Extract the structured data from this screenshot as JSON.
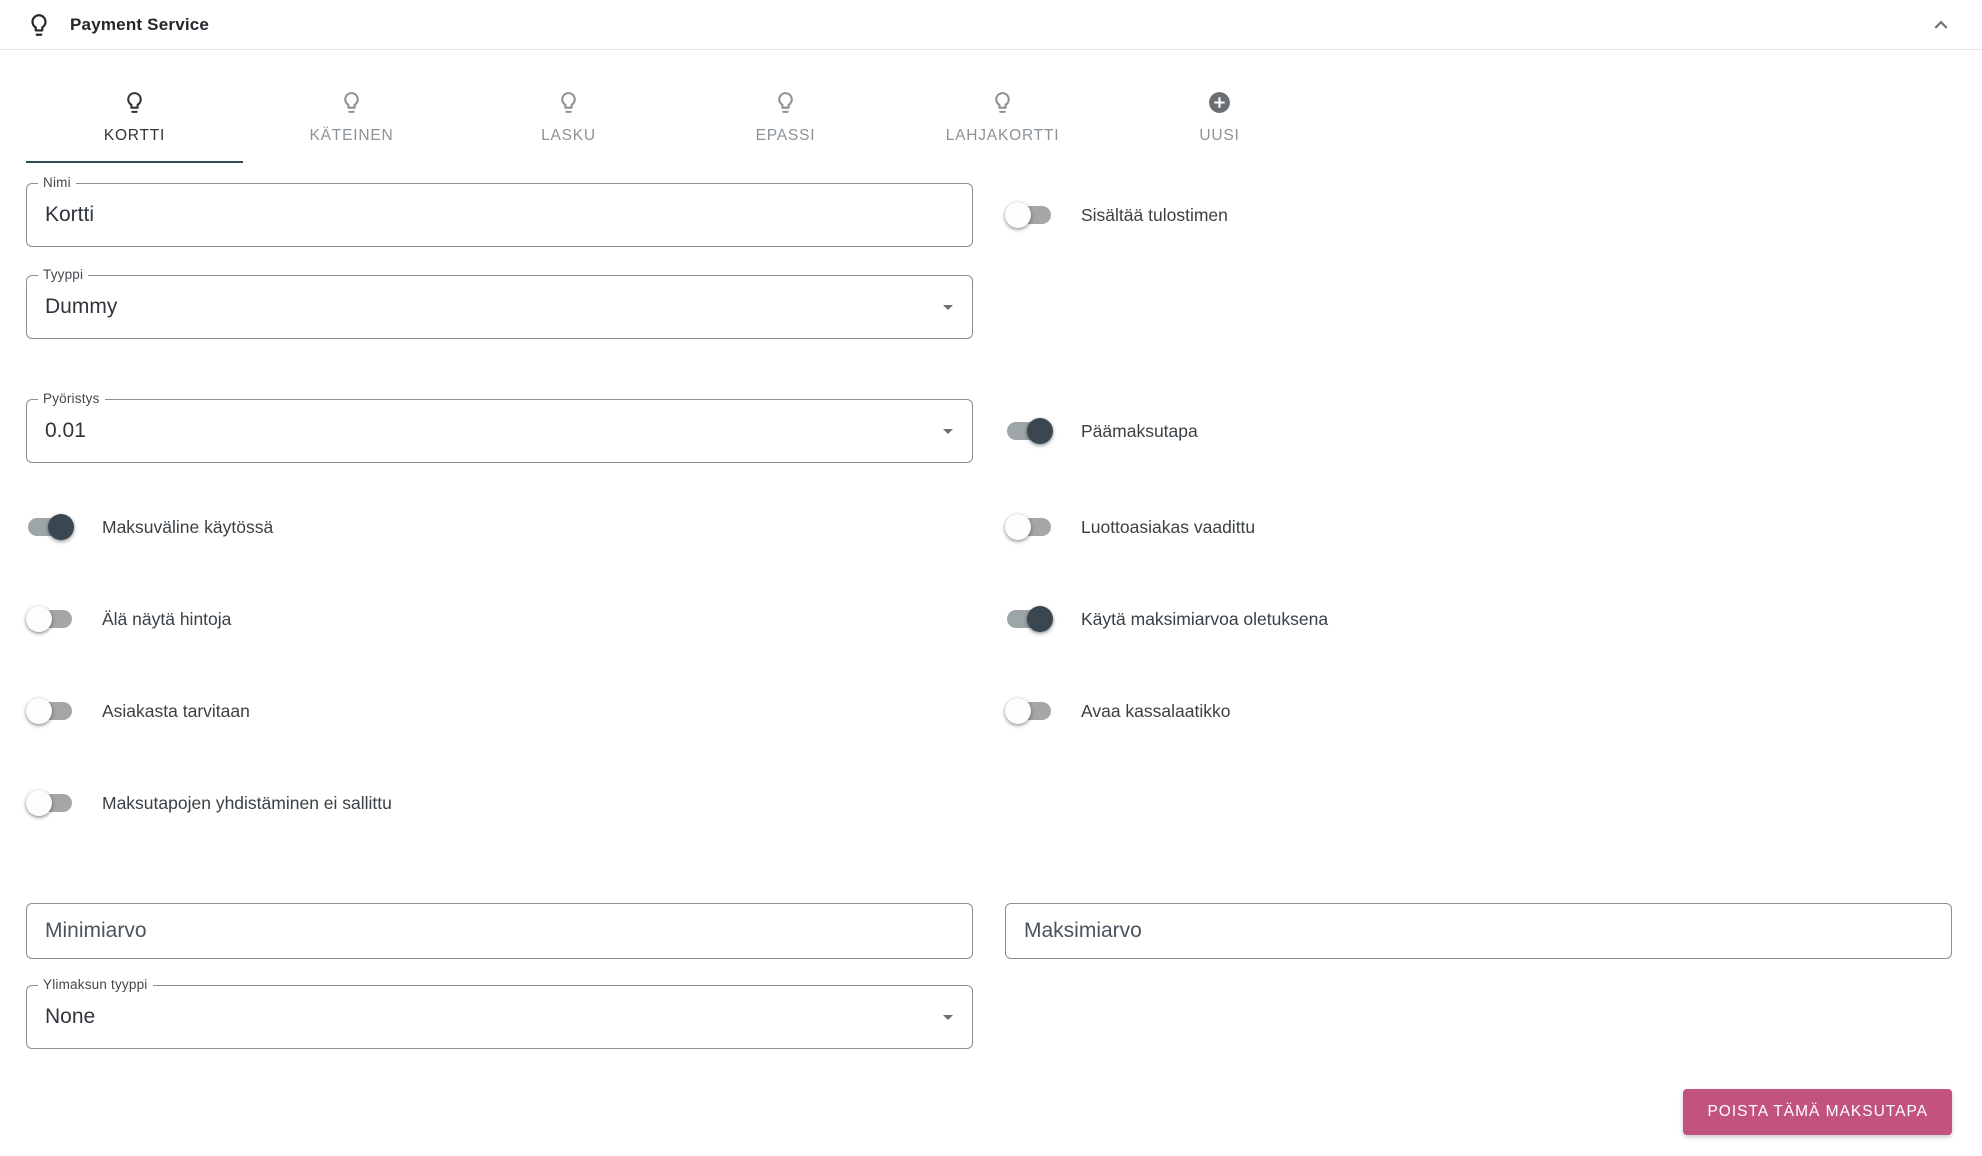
{
  "header": {
    "title": "Payment Service",
    "icon": "lightbulb-icon",
    "collapse_icon": "chevron-up-icon"
  },
  "tabs": [
    {
      "label": "KORTTI",
      "icon": "lightbulb-icon",
      "active": true
    },
    {
      "label": "KÄTEINEN",
      "icon": "lightbulb-icon",
      "active": false
    },
    {
      "label": "LASKU",
      "icon": "lightbulb-icon",
      "active": false
    },
    {
      "label": "EPASSI",
      "icon": "lightbulb-icon",
      "active": false
    },
    {
      "label": "LAHJAKORTTI",
      "icon": "lightbulb-icon",
      "active": false
    },
    {
      "label": "UUSI",
      "icon": "add-circle-icon",
      "active": false
    }
  ],
  "form": {
    "fields": {
      "nimi": {
        "label": "Nimi",
        "value": "Kortti"
      },
      "tyyppi": {
        "label": "Tyyppi",
        "value": "Dummy",
        "type": "select"
      },
      "pyoristys": {
        "label": "Pyöristys",
        "value": "0.01",
        "type": "select"
      },
      "minimiarvo": {
        "placeholder": "Minimiarvo",
        "value": ""
      },
      "maksimiarvo": {
        "placeholder": "Maksimiarvo",
        "value": ""
      },
      "ylimaksun_tyyppi": {
        "label": "Ylimaksun tyyppi",
        "value": "None",
        "type": "select"
      }
    },
    "toggles_left": [
      {
        "label": "Maksuväline käytössä",
        "on": true
      },
      {
        "label": "Älä näytä hintoja",
        "on": false
      },
      {
        "label": "Asiakasta tarvitaan",
        "on": false
      },
      {
        "label": "Maksutapojen yhdistäminen ei sallittu",
        "on": false
      }
    ],
    "toggles_right": [
      {
        "label": "Sisältää tulostimen",
        "on": false
      },
      {
        "label": "Päämaksutapa",
        "on": true
      },
      {
        "label": "Luottoasiakas vaadittu",
        "on": false
      },
      {
        "label": "Käytä maksimiarvoa oletuksena",
        "on": true
      },
      {
        "label": "Avaa kassalaatikko",
        "on": false
      }
    ],
    "delete_button_label": "POISTA TÄMÄ MAKSUTAPA"
  },
  "colors": {
    "accent_underline": "#2e4b59",
    "toggle_on": "#3a4750",
    "danger_button": "#c2537f"
  }
}
